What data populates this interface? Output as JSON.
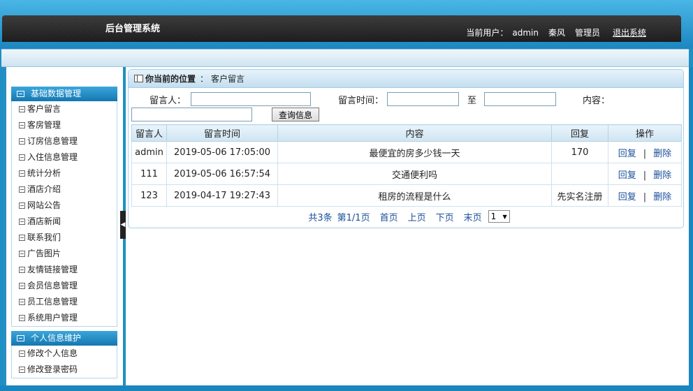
{
  "header": {
    "app_title": "后台管理系统",
    "current_user_label": "当前用户：",
    "username": "admin",
    "display_name": "秦风",
    "role": "管理员",
    "logout": "退出系统"
  },
  "sidebar": {
    "groups": [
      {
        "title": "基础数据管理",
        "items": [
          "客户留言",
          "客房管理",
          "订房信息管理",
          "入住信息管理",
          "统计分析",
          "酒店介绍",
          "网站公告",
          "酒店新闻",
          "联系我们",
          "广告图片",
          "友情链接管理",
          "会员信息管理",
          "员工信息管理",
          "系统用户管理"
        ]
      },
      {
        "title": "个人信息维护",
        "items": [
          "修改个人信息",
          "修改登录密码"
        ]
      }
    ]
  },
  "breadcrumb": {
    "label": "你当前的位置",
    "sep": "：",
    "current": "客户留言"
  },
  "search": {
    "author_label": "留言人：",
    "author_value": "",
    "time_label": "留言时间：",
    "time_from": "",
    "to_label": "至",
    "time_to": "",
    "content_label": "内容：",
    "content_value": "",
    "button": "查询信息"
  },
  "table": {
    "headers": [
      "留言人",
      "留言时间",
      "内容",
      "回复",
      "操作"
    ],
    "rows": [
      {
        "author": "admin",
        "time": "2019-05-06 17:05:00",
        "content": "最便宜的房多少钱一天",
        "reply": "170"
      },
      {
        "author": "111",
        "time": "2019-05-06 16:57:54",
        "content": "交通便利吗",
        "reply": ""
      },
      {
        "author": "123",
        "time": "2019-04-17 19:27:43",
        "content": "租房的流程是什么",
        "reply": "先实名注册"
      }
    ],
    "action_reply": "回复",
    "action_sep": "|",
    "action_delete": "删除"
  },
  "pager": {
    "total": "共3条",
    "page_info": "第1/1页",
    "first": "首页",
    "prev": "上页",
    "next": "下页",
    "last": "末页",
    "page_select": "1"
  },
  "icons": {
    "menu_head": "panel-icon",
    "menu_item": "page-icon",
    "breadcrumb": "window-icon",
    "collapse": "triangle-left-icon"
  },
  "colors": {
    "frame": "#1f8fc4",
    "header_dark": "#2a2a2a",
    "link": "#1a4f9a"
  }
}
